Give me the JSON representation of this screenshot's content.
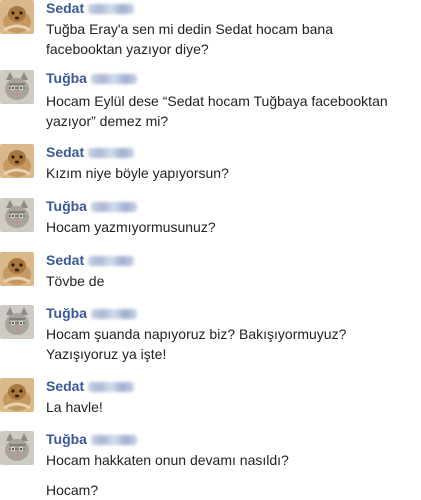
{
  "messages": [
    {
      "sender": "Sedat",
      "avatar": "sedat",
      "lines": [
        "Tuğba Eray'a sen mi dedin Sedat hocam bana",
        "facebooktan yazıyor diye?"
      ]
    },
    {
      "sender": "Tuğba",
      "avatar": "tugba",
      "lines": [
        "Hocam Eylül dese “Sedat hocam Tuğbaya facebooktan",
        "yazıyor” demez mi?"
      ]
    },
    {
      "sender": "Sedat",
      "avatar": "sedat",
      "lines": [
        "Kızım niye böyle yapıyorsun?"
      ]
    },
    {
      "sender": "Tuğba",
      "avatar": "tugba",
      "lines": [
        "Hocam yazmıyormusunuz?"
      ]
    },
    {
      "sender": "Sedat",
      "avatar": "sedat",
      "lines": [
        "Tövbe de"
      ]
    },
    {
      "sender": "Tuğba",
      "avatar": "tugba",
      "lines": [
        "Hocam şuanda napıyoruz biz? Bakışıyormuyuz?",
        "Yazışıyoruz ya işte!"
      ]
    },
    {
      "sender": "Sedat",
      "avatar": "sedat",
      "lines": [
        "La havle!"
      ]
    },
    {
      "sender": "Tuğba",
      "avatar": "tugba",
      "lines": [
        "Hocam hakkaten onun devamı nasıldı?",
        "Hocam?"
      ]
    }
  ],
  "colors": {
    "name": "#3b5998",
    "text": "#222222"
  }
}
